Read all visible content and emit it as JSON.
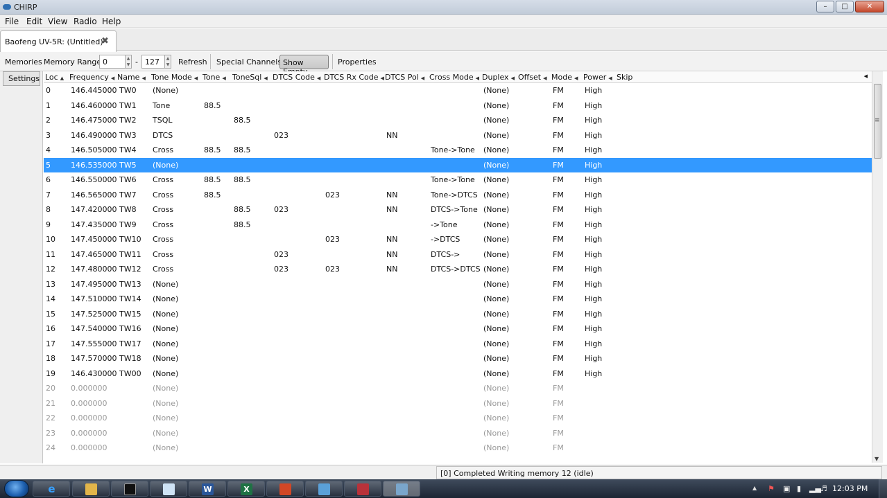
{
  "window": {
    "title": "CHIRP"
  },
  "menu": [
    "File",
    "Edit",
    "View",
    "Radio",
    "Help"
  ],
  "tab": {
    "label": "Baofeng UV-5R: (Untitled)*"
  },
  "toolbar": {
    "memories_label": "Memories",
    "range_label": "Memory Range:",
    "range_start": "0",
    "range_dash": "-",
    "range_end": "127",
    "refresh": "Refresh",
    "special_channels": "Special Channels",
    "show_empty": "Show Empty",
    "properties": "Properties"
  },
  "side": {
    "settings": "Settings"
  },
  "columns": [
    "Loc",
    "Frequency",
    "Name",
    "Tone Mode",
    "Tone",
    "ToneSql",
    "DTCS Code",
    "DTCS Rx Code",
    "DTCS Pol",
    "Cross Mode",
    "Duplex",
    "Offset",
    "Mode",
    "Power",
    "Skip"
  ],
  "rows": [
    [
      "0",
      "146.445000",
      "TW0",
      "(None)",
      "",
      "",
      "",
      "",
      "",
      "",
      "(None)",
      "",
      "FM",
      "High",
      ""
    ],
    [
      "1",
      "146.460000",
      "TW1",
      "Tone",
      "88.5",
      "",
      "",
      "",
      "",
      "",
      "(None)",
      "",
      "FM",
      "High",
      ""
    ],
    [
      "2",
      "146.475000",
      "TW2",
      "TSQL",
      "",
      "88.5",
      "",
      "",
      "",
      "",
      "(None)",
      "",
      "FM",
      "High",
      ""
    ],
    [
      "3",
      "146.490000",
      "TW3",
      "DTCS",
      "",
      "",
      "023",
      "",
      "NN",
      "",
      "(None)",
      "",
      "FM",
      "High",
      ""
    ],
    [
      "4",
      "146.505000",
      "TW4",
      "Cross",
      "88.5",
      "88.5",
      "",
      "",
      "",
      "Tone->Tone",
      "(None)",
      "",
      "FM",
      "High",
      ""
    ],
    [
      "5",
      "146.535000",
      "TW5",
      "(None)",
      "",
      "",
      "",
      "",
      "",
      "",
      "(None)",
      "",
      "FM",
      "High",
      ""
    ],
    [
      "6",
      "146.550000",
      "TW6",
      "Cross",
      "88.5",
      "88.5",
      "",
      "",
      "",
      "Tone->Tone",
      "(None)",
      "",
      "FM",
      "High",
      ""
    ],
    [
      "7",
      "146.565000",
      "TW7",
      "Cross",
      "88.5",
      "",
      "",
      "023",
      "NN",
      "Tone->DTCS",
      "(None)",
      "",
      "FM",
      "High",
      ""
    ],
    [
      "8",
      "147.420000",
      "TW8",
      "Cross",
      "",
      "88.5",
      "023",
      "",
      "NN",
      "DTCS->Tone",
      "(None)",
      "",
      "FM",
      "High",
      ""
    ],
    [
      "9",
      "147.435000",
      "TW9",
      "Cross",
      "",
      "88.5",
      "",
      "",
      "",
      "->Tone",
      "(None)",
      "",
      "FM",
      "High",
      ""
    ],
    [
      "10",
      "147.450000",
      "TW10",
      "Cross",
      "",
      "",
      "",
      "023",
      "NN",
      "->DTCS",
      "(None)",
      "",
      "FM",
      "High",
      ""
    ],
    [
      "11",
      "147.465000",
      "TW11",
      "Cross",
      "",
      "",
      "023",
      "",
      "NN",
      "DTCS->",
      "(None)",
      "",
      "FM",
      "High",
      ""
    ],
    [
      "12",
      "147.480000",
      "TW12",
      "Cross",
      "",
      "",
      "023",
      "023",
      "NN",
      "DTCS->DTCS",
      "(None)",
      "",
      "FM",
      "High",
      ""
    ],
    [
      "13",
      "147.495000",
      "TW13",
      "(None)",
      "",
      "",
      "",
      "",
      "",
      "",
      "(None)",
      "",
      "FM",
      "High",
      ""
    ],
    [
      "14",
      "147.510000",
      "TW14",
      "(None)",
      "",
      "",
      "",
      "",
      "",
      "",
      "(None)",
      "",
      "FM",
      "High",
      ""
    ],
    [
      "15",
      "147.525000",
      "TW15",
      "(None)",
      "",
      "",
      "",
      "",
      "",
      "",
      "(None)",
      "",
      "FM",
      "High",
      ""
    ],
    [
      "16",
      "147.540000",
      "TW16",
      "(None)",
      "",
      "",
      "",
      "",
      "",
      "",
      "(None)",
      "",
      "FM",
      "High",
      ""
    ],
    [
      "17",
      "147.555000",
      "TW17",
      "(None)",
      "",
      "",
      "",
      "",
      "",
      "",
      "(None)",
      "",
      "FM",
      "High",
      ""
    ],
    [
      "18",
      "147.570000",
      "TW18",
      "(None)",
      "",
      "",
      "",
      "",
      "",
      "",
      "(None)",
      "",
      "FM",
      "High",
      ""
    ],
    [
      "19",
      "146.430000",
      "TW00",
      "(None)",
      "",
      "",
      "",
      "",
      "",
      "",
      "(None)",
      "",
      "FM",
      "High",
      ""
    ],
    [
      "20",
      "0.000000",
      "",
      "(None)",
      "",
      "",
      "",
      "",
      "",
      "",
      "(None)",
      "",
      "FM",
      "",
      ""
    ],
    [
      "21",
      "0.000000",
      "",
      "(None)",
      "",
      "",
      "",
      "",
      "",
      "",
      "(None)",
      "",
      "FM",
      "",
      ""
    ],
    [
      "22",
      "0.000000",
      "",
      "(None)",
      "",
      "",
      "",
      "",
      "",
      "",
      "(None)",
      "",
      "FM",
      "",
      ""
    ],
    [
      "23",
      "0.000000",
      "",
      "(None)",
      "",
      "",
      "",
      "",
      "",
      "",
      "(None)",
      "",
      "FM",
      "",
      ""
    ],
    [
      "24",
      "0.000000",
      "",
      "(None)",
      "",
      "",
      "",
      "",
      "",
      "",
      "(None)",
      "",
      "FM",
      "",
      ""
    ]
  ],
  "selected_row": "5",
  "status": "[0] Completed Writing memory 12 (idle)",
  "clock": "12:03 PM",
  "colors": {
    "selection": "#3399ff",
    "empty_text": "#9a9a9a"
  }
}
